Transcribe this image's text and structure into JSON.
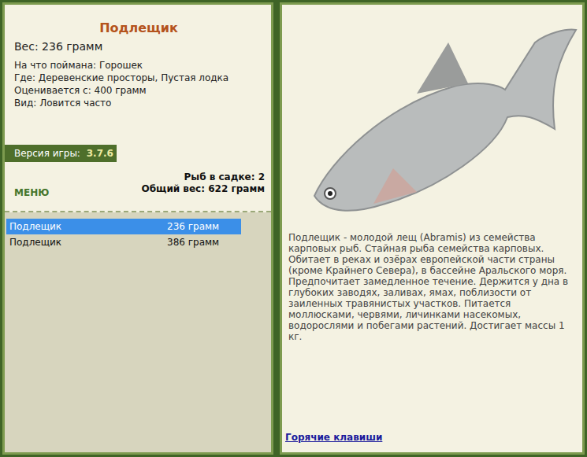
{
  "fish_card": {
    "title": "Подлещик",
    "weight": "Вес: 236 грамм",
    "details": [
      "На что поймана: Горошек",
      "Где: Деревенские просторы, Пустая лодка",
      "Оценивается с: 400 грамм",
      "Вид: Ловится часто"
    ]
  },
  "version": {
    "label": "Версия игры:",
    "value": "3.7.6"
  },
  "menu_button": "МЕНЮ",
  "keepnet_summary": [
    "Рыб в садке: 2",
    "Общий вес: 622 грамм"
  ],
  "catch_list": [
    {
      "name": "Подлещик",
      "weight": "236 грамм",
      "selected": true
    },
    {
      "name": "Подлещик",
      "weight": "386 грамм",
      "selected": false
    }
  ],
  "description": "Подлещик - молодой лещ (Abramis) из семейства карповых рыб. Стайная рыба семейства карповых. Обитает в реках и озёрах европейской части страны (кроме Крайнего Севера), в бассейне Аральского моря. Предпочитает замедленное течение. Держится у дна в глубоких заводях, заливах, ямах, поблизости от заиленных травянистых участков. Питается моллюсками, червями, личинками насекомых, водорослями и побегами растений. Достигает массы 1 кг.",
  "hotkeys_link": "Горячие клавиши"
}
